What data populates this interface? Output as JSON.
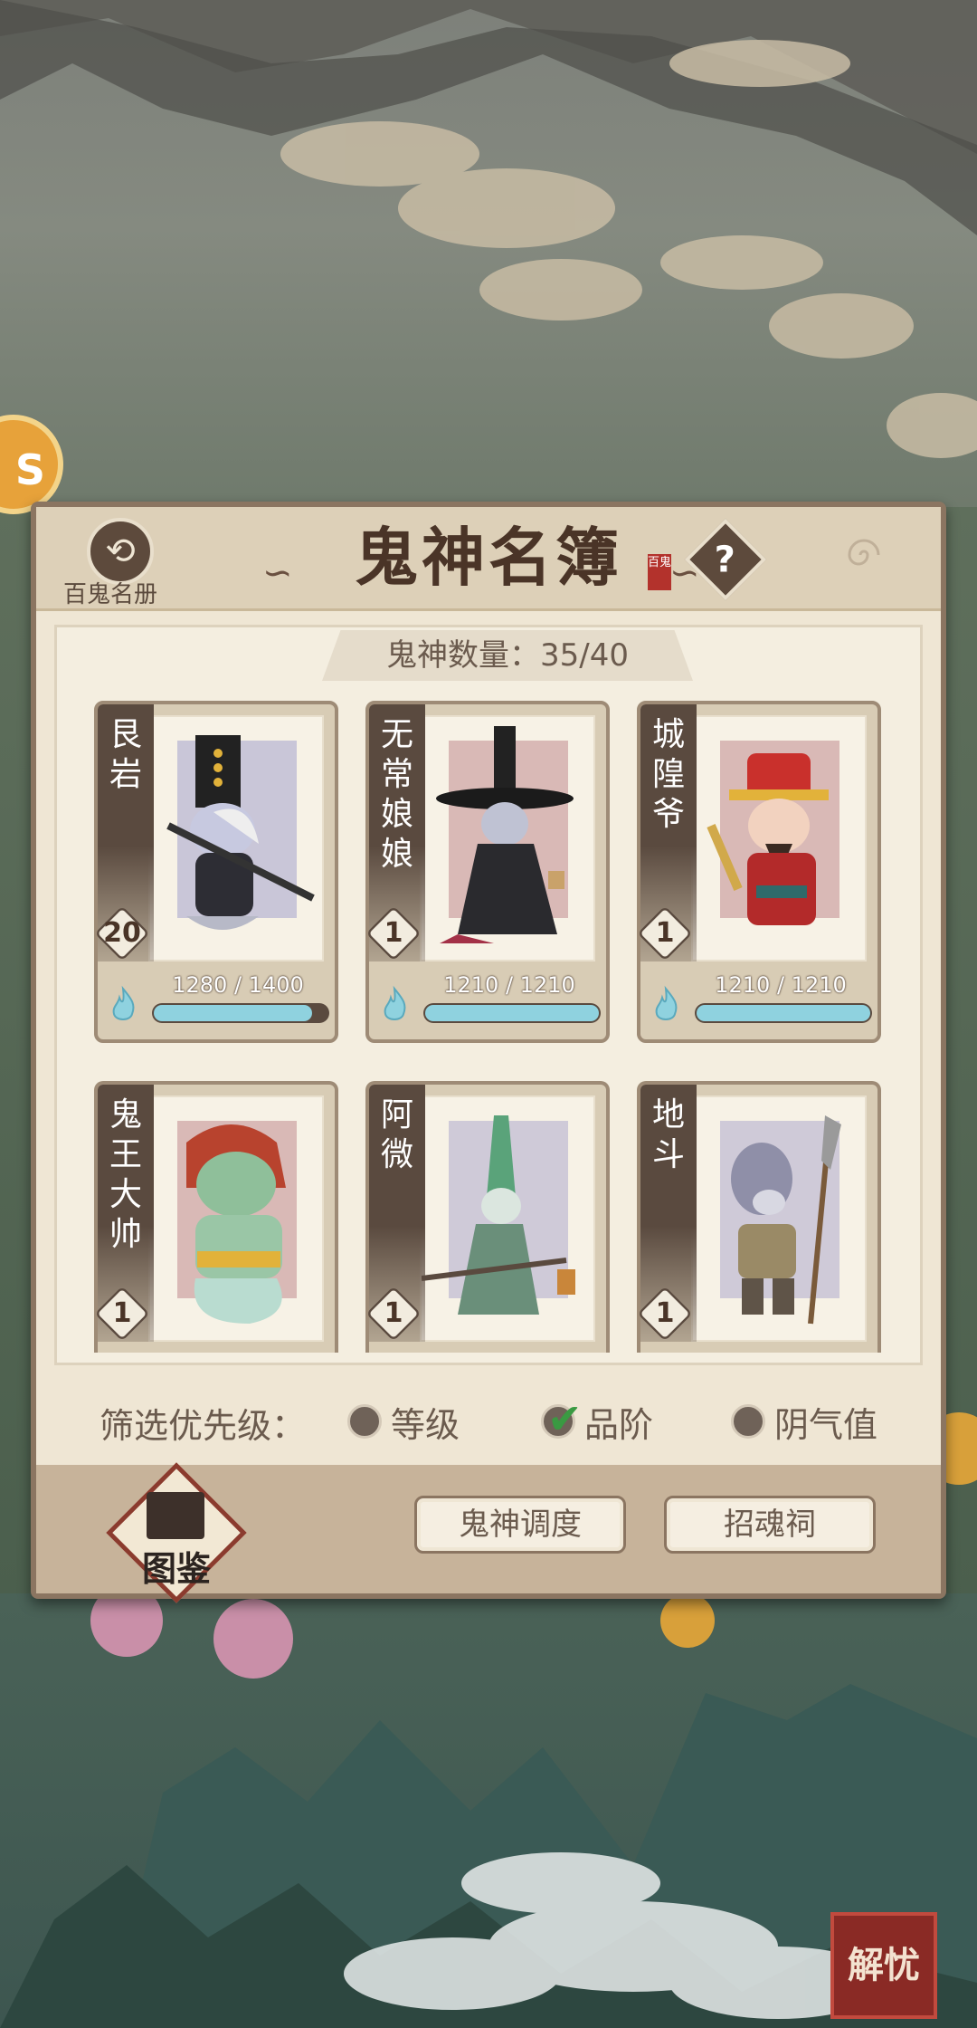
{
  "header": {
    "title": "鬼神名簿",
    "seal_text": "百鬼",
    "back_label": "百鬼名册",
    "back_icon": "swirl-back-icon",
    "help_icon": "question-icon"
  },
  "count": {
    "text": "鬼神数量：35/40"
  },
  "cards": [
    {
      "name": "艮岩",
      "level": "20",
      "hp_text": "1280 / 1400",
      "hp_fraction": 0.914,
      "wash": "#c9c6d8"
    },
    {
      "name": "无常娘娘",
      "level": "1",
      "hp_text": "1210 / 1210",
      "hp_fraction": 1.0,
      "wash": "#d9b9b6"
    },
    {
      "name": "城隍爷",
      "level": "1",
      "hp_text": "1210 / 1210",
      "hp_fraction": 1.0,
      "wash": "#d9b9b6"
    },
    {
      "name": "鬼王大帅",
      "level": "1",
      "wash": "#d9b9b6"
    },
    {
      "name": "阿微",
      "level": "1",
      "wash": "#cfcad8"
    },
    {
      "name": "地斗",
      "level": "1",
      "wash": "#cfcad8"
    }
  ],
  "filter": {
    "label": "筛选优先级：",
    "options": [
      {
        "label": "等级",
        "checked": false
      },
      {
        "label": "品阶",
        "checked": true
      },
      {
        "label": "阴气值",
        "checked": false
      }
    ]
  },
  "footer": {
    "atlas_label": "图鉴",
    "dispatch_button": "鬼神调度",
    "shrine_button": "招魂祠"
  },
  "corner_stamp": "解忧",
  "colors": {
    "panel_bg": "#efe6d4",
    "panel_border": "#8b7561",
    "hp_fill": "#8fd2df",
    "name_strip": "#5a4a3f",
    "check": "#3a9a42"
  }
}
